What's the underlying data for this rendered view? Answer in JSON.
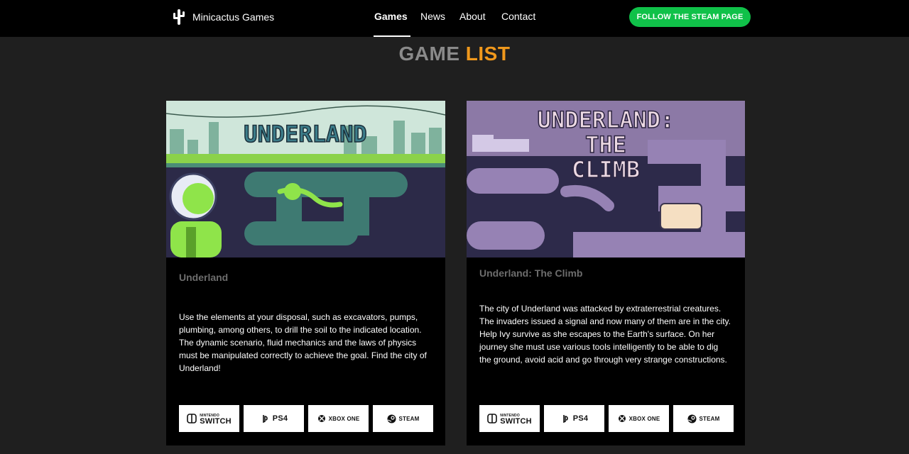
{
  "brand": {
    "name": "Minicactus Games",
    "logo_icon": "cactus-icon"
  },
  "nav": {
    "items": [
      {
        "label": "Games",
        "active": true
      },
      {
        "label": "News",
        "active": false
      },
      {
        "label": "About",
        "active": false
      },
      {
        "label": "Contact",
        "active": false
      }
    ],
    "cta_label": "FOLLOW THE STEAM PAGE",
    "cta_color": "#10c149"
  },
  "page": {
    "title_part1": "GAME",
    "title_part2": "LIST",
    "accent": "#f0981c"
  },
  "games": [
    {
      "title": "Underland",
      "cover_text": "UNDERLAND",
      "description": "Use the elements at your disposal, such as excavators, pumps, plumbing, among others, to drill the soil to the indicated location. The dynamic scenario, fluid mechanics and the laws of physics must be manipulated correctly to achieve the goal. Find the city of Underland!",
      "platforms": [
        {
          "label": "SWITCH",
          "sub": "NINTENDO",
          "icon": "nintendo-switch-icon"
        },
        {
          "label": "PS4",
          "icon": "playstation-icon"
        },
        {
          "label": "XBOX ONE",
          "icon": "xbox-icon"
        },
        {
          "label": "STEAM",
          "icon": "steam-icon"
        }
      ]
    },
    {
      "title": "Underland: The Climb",
      "cover_text": [
        "UNDERLAND:",
        "THE",
        "CLIMB"
      ],
      "description": "The city of Underland was attacked by extraterrestrial creatures. The invaders issued a signal and now many of them are in the city. Help Ivy survive as she escapes to the Earth's surface. On her journey she must use various tools intelligently to be able to dig the ground, avoid acid and go through very strange constructions.",
      "platforms": [
        {
          "label": "SWITCH",
          "sub": "NINTENDO",
          "icon": "nintendo-switch-icon"
        },
        {
          "label": "PS4",
          "icon": "playstation-icon"
        },
        {
          "label": "XBOX ONE",
          "icon": "xbox-icon"
        },
        {
          "label": "STEAM",
          "icon": "steam-icon"
        }
      ]
    }
  ]
}
